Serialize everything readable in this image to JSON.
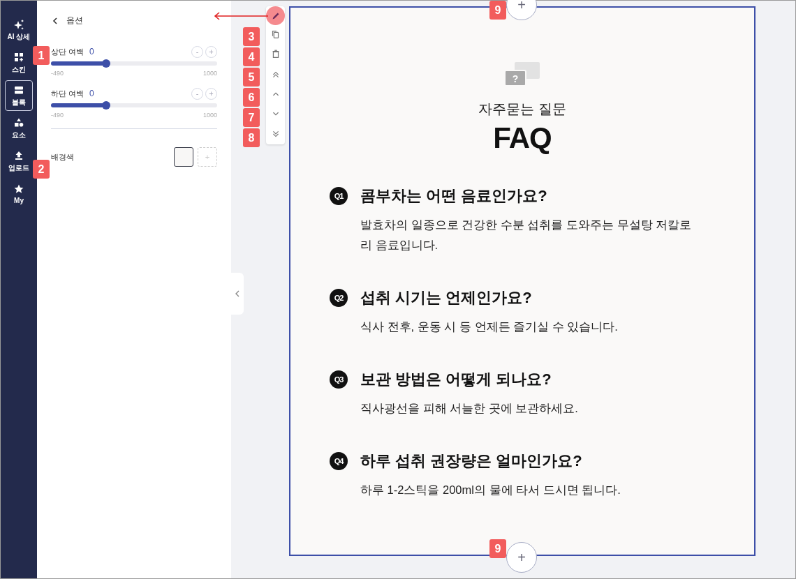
{
  "nav": [
    {
      "label": "AI 상세",
      "kind": "sparkle",
      "selected": false
    },
    {
      "label": "스킨",
      "kind": "grid",
      "selected": false
    },
    {
      "label": "블록",
      "kind": "blocks",
      "selected": true
    },
    {
      "label": "요소",
      "kind": "shapes",
      "selected": false
    },
    {
      "label": "업로드",
      "kind": "upload",
      "selected": false
    },
    {
      "label": "My",
      "kind": "star",
      "selected": false
    }
  ],
  "panel": {
    "title": "옵션",
    "sliders": [
      {
        "label": "상단 여백",
        "value": "0",
        "level": 0.33,
        "min": "-490",
        "max": "1000",
        "minus": "-",
        "plus": "+"
      },
      {
        "label": "하단 여백",
        "value": "0",
        "level": 0.33,
        "min": "-490",
        "max": "1000",
        "minus": "-",
        "plus": "+"
      }
    ],
    "background": {
      "label": "배경색",
      "color": "#f8f7f6",
      "add": "+"
    }
  },
  "toolbar": [
    {
      "kind": "edit",
      "selected": true
    },
    {
      "kind": "copy",
      "selected": false
    },
    {
      "kind": "delete",
      "selected": false
    },
    {
      "kind": "top",
      "selected": false
    },
    {
      "kind": "up",
      "selected": false
    },
    {
      "kind": "down",
      "selected": false
    },
    {
      "kind": "bottom",
      "selected": false
    }
  ],
  "block": {
    "icon_mark": "?",
    "subtitle": "자주묻는 질문",
    "title": "FAQ",
    "items": [
      {
        "badge": "Q1",
        "question": "콤부차는 어떤 음료인가요?",
        "answer": "발효차의 일종으로 건강한 수분 섭취를 도와주는 무설탕 저칼로리 음료입니다."
      },
      {
        "badge": "Q2",
        "question": "섭취 시기는 언제인가요?",
        "answer": "식사 전후, 운동 시 등 언제든 즐기실 수 있습니다."
      },
      {
        "badge": "Q3",
        "question": "보관 방법은 어떻게 되나요?",
        "answer": "직사광선을 피해 서늘한 곳에 보관하세요."
      },
      {
        "badge": "Q4",
        "question": "하루 섭취 권장량은 얼마인가요?",
        "answer": "하루 1-2스틱을 200ml의 물에 타서 드시면 됩니다."
      }
    ]
  },
  "add_buttons": [
    "+",
    "+"
  ],
  "annotations": [
    "1",
    "2",
    "3",
    "4",
    "5",
    "6",
    "7",
    "8",
    "9",
    "9"
  ]
}
